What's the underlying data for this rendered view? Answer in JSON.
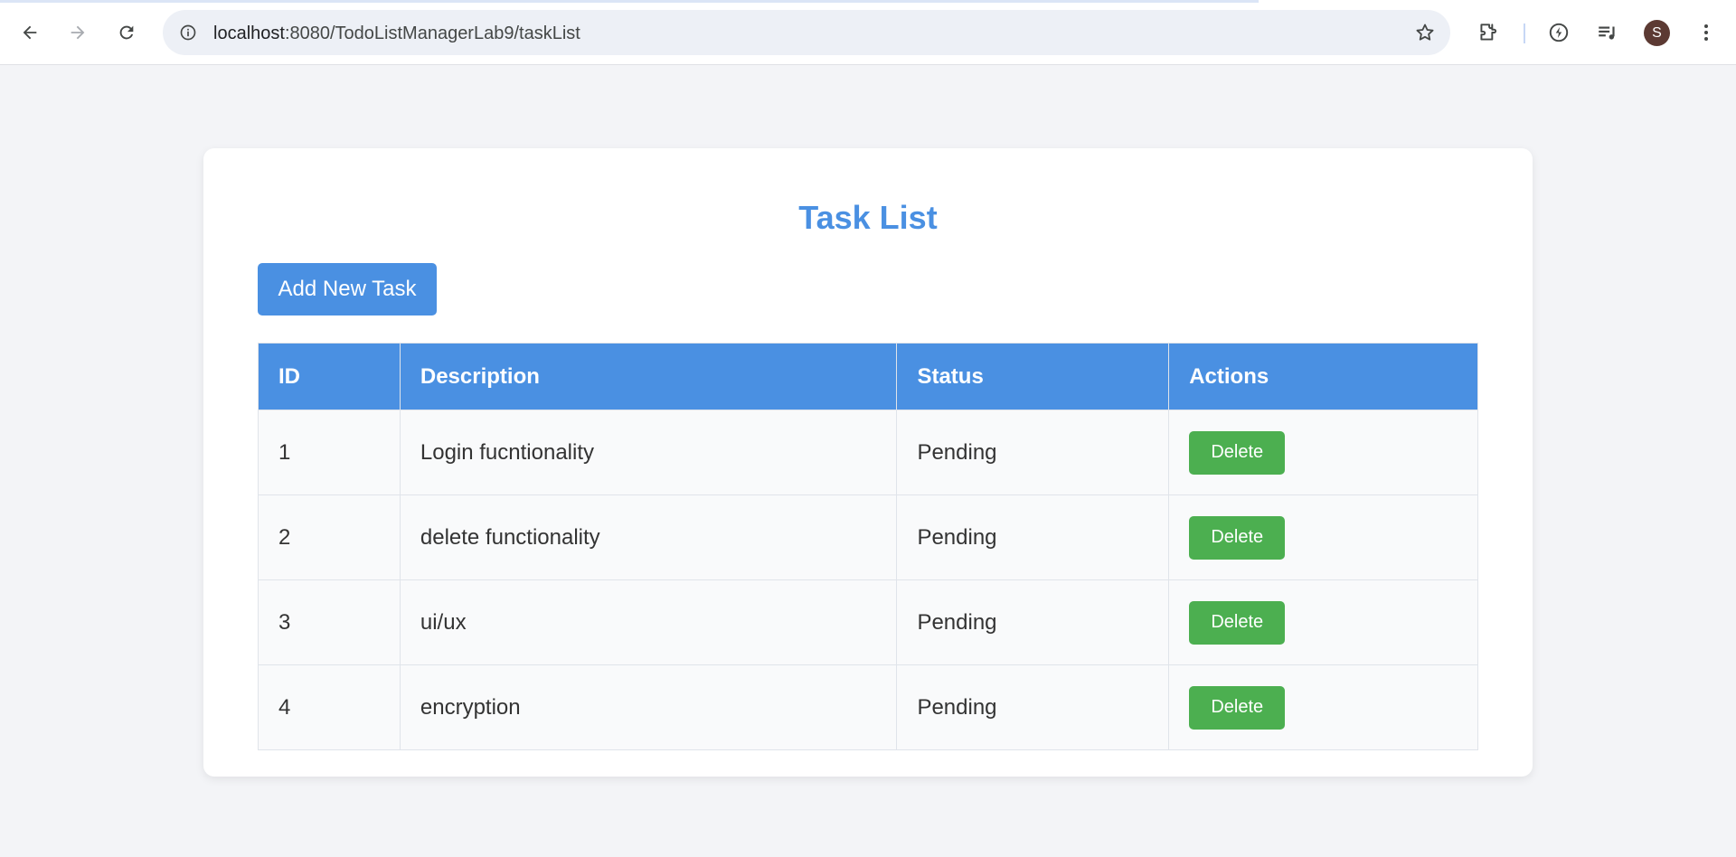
{
  "browser": {
    "url_host": "localhost",
    "url_path": ":8080/TodoListManagerLab9/taskList",
    "avatar_letter": "S",
    "icons": [
      "back-arrow-icon",
      "forward-arrow-icon",
      "reload-icon",
      "site-info-icon",
      "bookmark-star-icon",
      "extensions-icon",
      "performance-icon",
      "media-control-icon",
      "more-menu-icon"
    ]
  },
  "page": {
    "title": "Task List",
    "add_button_label": "Add New Task",
    "columns": [
      "ID",
      "Description",
      "Status",
      "Actions"
    ],
    "rows": [
      {
        "id": "1",
        "description": "Login fucntionality",
        "status": "Pending",
        "action": "Delete"
      },
      {
        "id": "2",
        "description": "delete functionality",
        "status": "Pending",
        "action": "Delete"
      },
      {
        "id": "3",
        "description": "ui/ux",
        "status": "Pending",
        "action": "Delete"
      },
      {
        "id": "4",
        "description": "encryption",
        "status": "Pending",
        "action": "Delete"
      }
    ]
  },
  "colors": {
    "primary": "#4a90e2",
    "delete_button": "#4caf50",
    "background": "#f3f4f7"
  }
}
